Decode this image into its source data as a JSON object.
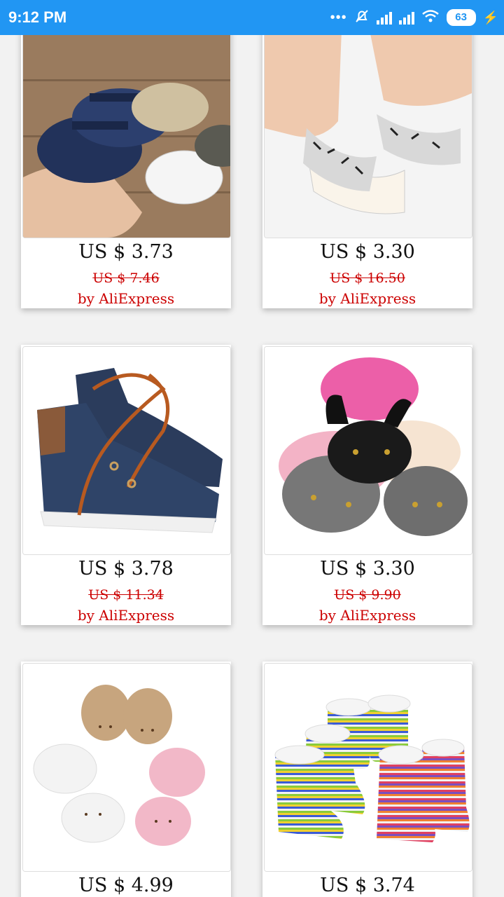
{
  "status": {
    "time": "9:12 PM",
    "battery": "63"
  },
  "products": [
    {
      "price": "US $ 3.73",
      "original": "US $ 7.46",
      "seller": "by AliExpress",
      "image": "navy-and-white-sandals"
    },
    {
      "price": "US $ 3.30",
      "original": "US $ 16.50",
      "seller": "by AliExpress",
      "image": "patterned-sandals-on-feet"
    },
    {
      "price": "US $ 3.78",
      "original": "US $ 11.34",
      "seller": "by AliExpress",
      "image": "navy-high-top-sneakers"
    },
    {
      "price": "US $ 3.30",
      "original": "US $ 9.90",
      "seller": "by AliExpress",
      "image": "bunny-mary-jane-shoes"
    },
    {
      "price": "US $ 4.99",
      "original": "",
      "seller": "",
      "image": "cat-face-slippers"
    },
    {
      "price": "US $ 3.74",
      "original": "",
      "seller": "",
      "image": "striped-fleece-boots"
    }
  ]
}
